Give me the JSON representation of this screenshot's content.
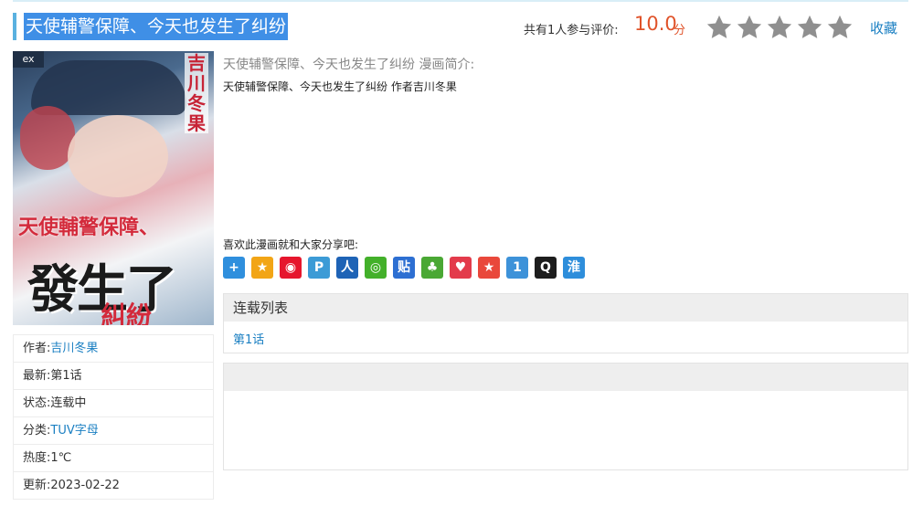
{
  "header": {
    "title": "天使辅警保障、今天也发生了纠纷",
    "rating_text": "共有1人参与评价:",
    "score": "10.0",
    "score_unit": "分",
    "stars_filled": 0,
    "stars_total": 5,
    "favorite_label": "收藏"
  },
  "cover": {
    "publisher": "ex",
    "author_vertical": "吉川冬果",
    "line1": "天使輔警保障、",
    "line2": "發生了",
    "line3": "糾紛"
  },
  "info": {
    "rows": [
      {
        "key": "作者:",
        "value": "吉川冬果",
        "link": true
      },
      {
        "key": "最新:",
        "value": "第1话",
        "link": false
      },
      {
        "key": "状态:",
        "value": "连载中",
        "link": false
      },
      {
        "key": "分类:",
        "value": "TUV字母",
        "link": true
      },
      {
        "key": "热度:",
        "value": "1℃",
        "link": false
      },
      {
        "key": "更新:",
        "value": "2023-02-22",
        "link": false
      }
    ]
  },
  "description": {
    "heading": "天使辅警保障、今天也发生了纠纷 漫画简介:",
    "body": "天使辅警保障、今天也发生了纠纷 作者吉川冬果"
  },
  "share": {
    "label": "喜欢此漫画就和大家分享吧:",
    "icons": [
      {
        "name": "share-more-icon",
        "glyph": "+",
        "color": "#2f8fdd"
      },
      {
        "name": "qzone-icon",
        "glyph": "★",
        "color": "#f2a516"
      },
      {
        "name": "weibo-icon",
        "glyph": "◉",
        "color": "#e6162d"
      },
      {
        "name": "tencent-weibo-icon",
        "glyph": "P",
        "color": "#3c9bd6"
      },
      {
        "name": "renren-icon",
        "glyph": "人",
        "color": "#1e63b6"
      },
      {
        "name": "wechat-icon",
        "glyph": "◎",
        "color": "#43b02a"
      },
      {
        "name": "tieba-icon",
        "glyph": "贴",
        "color": "#2d6fd2"
      },
      {
        "name": "clover-icon",
        "glyph": "♣",
        "color": "#4aa834"
      },
      {
        "name": "heart-icon",
        "glyph": "♥",
        "color": "#e33b4b"
      },
      {
        "name": "star-badge-icon",
        "glyph": "★",
        "color": "#e9483b"
      },
      {
        "name": "kaixin-icon",
        "glyph": "1",
        "color": "#3d92d9"
      },
      {
        "name": "qq-icon",
        "glyph": "Q",
        "color": "#1d1d1d"
      },
      {
        "name": "huaban-icon",
        "glyph": "淮",
        "color": "#2e8edb"
      }
    ]
  },
  "chapters": {
    "heading": "连载列表",
    "items": [
      "第1话"
    ]
  },
  "colors": {
    "accent": "#3f8fe6",
    "link": "#1a7fc2",
    "score": "#e0532a"
  }
}
